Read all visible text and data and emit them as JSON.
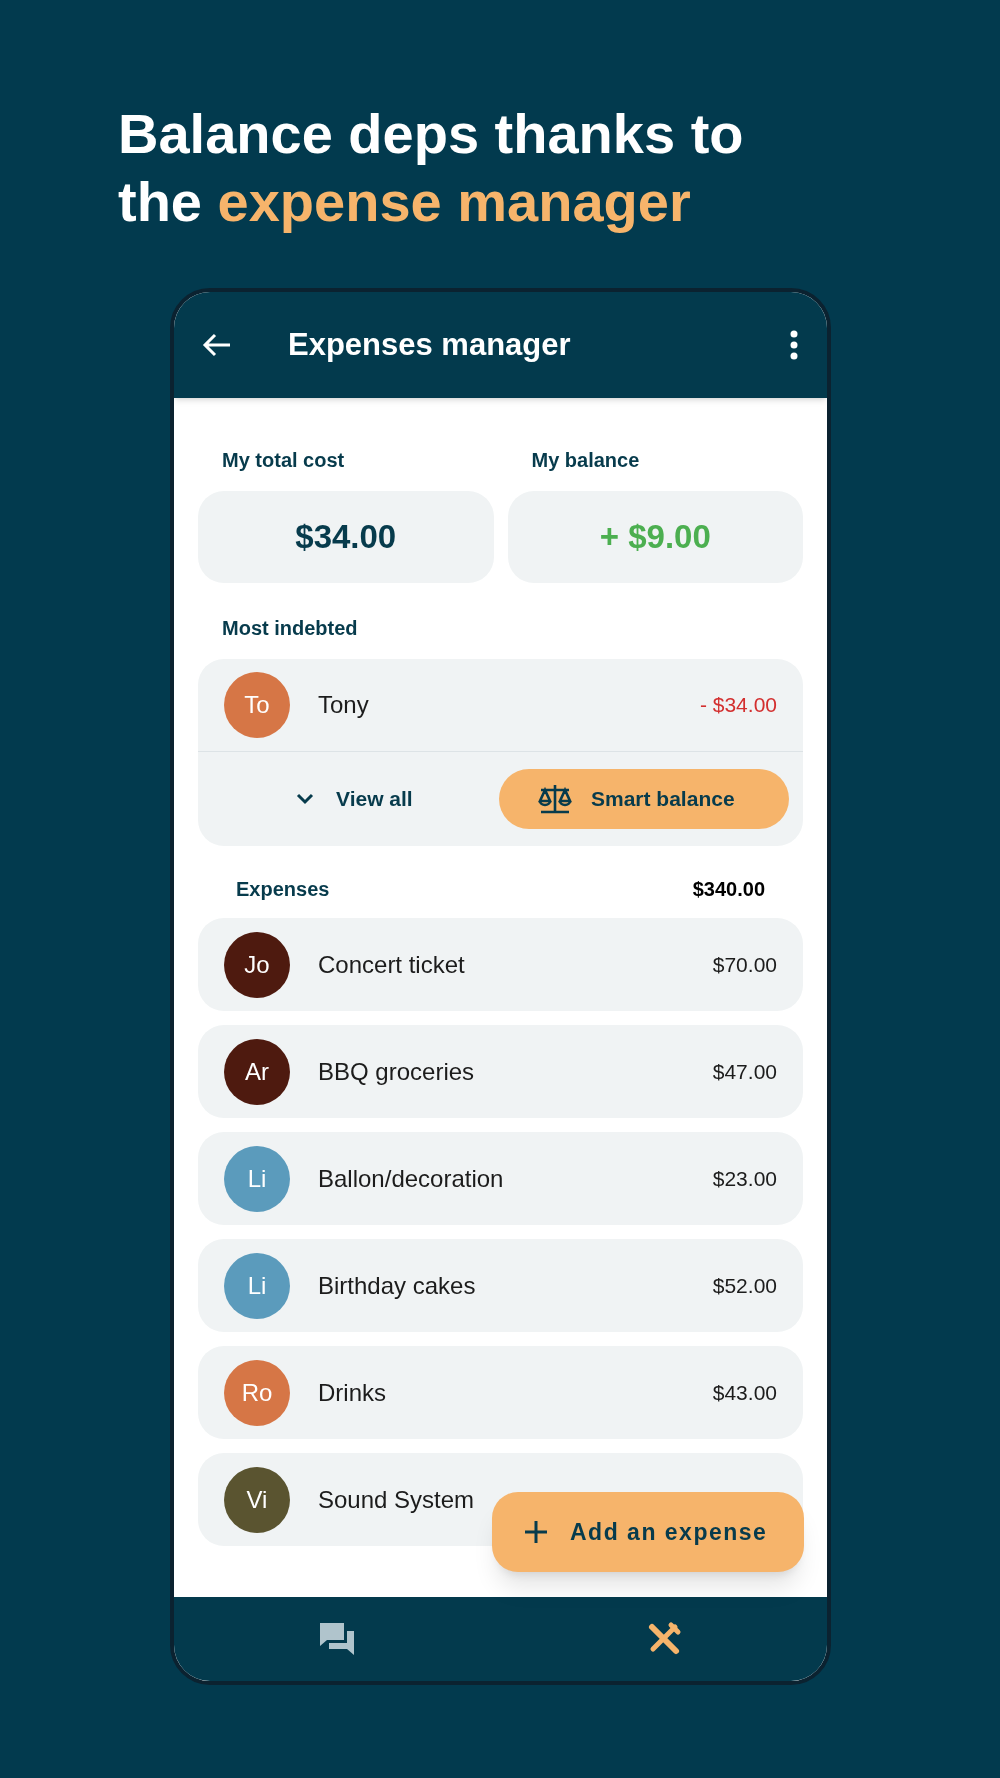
{
  "headline": {
    "text": "Balance deps thanks to the ",
    "highlight": "expense manager"
  },
  "app_bar": {
    "title": "Expenses manager"
  },
  "summary": [
    {
      "label": "My total cost",
      "value": "$34.00",
      "kind": "neutral"
    },
    {
      "label": "My balance",
      "value": "+ $9.00",
      "kind": "positive"
    }
  ],
  "most_indebted": {
    "title": "Most indebted",
    "person": {
      "initials": "To",
      "name": "Tony",
      "amount": "- $34.00",
      "color": "#d67646"
    },
    "view_all": "View all",
    "smart_balance": "Smart balance"
  },
  "expenses": {
    "title": "Expenses",
    "total": "$340.00",
    "rows": [
      {
        "initials": "Jo",
        "name": "Concert ticket",
        "amount": "$70.00",
        "color": "#4e1a0f"
      },
      {
        "initials": "Ar",
        "name": "BBQ groceries",
        "amount": "$47.00",
        "color": "#4e1a0f"
      },
      {
        "initials": "Li",
        "name": "Ballon/decoration",
        "amount": "$23.00",
        "color": "#5b9bbc"
      },
      {
        "initials": "Li",
        "name": "Birthday cakes",
        "amount": "$52.00",
        "color": "#5b9bbc"
      },
      {
        "initials": "Ro",
        "name": "Drinks",
        "amount": "$43.00",
        "color": "#d67646"
      },
      {
        "initials": "Vi",
        "name": "Sound System",
        "color": "#5a5430"
      }
    ]
  },
  "fab": {
    "label": "Add an expense"
  },
  "bottom_nav": [
    {
      "kind": "chat",
      "selected": false
    },
    {
      "kind": "tools",
      "selected": true
    }
  ]
}
